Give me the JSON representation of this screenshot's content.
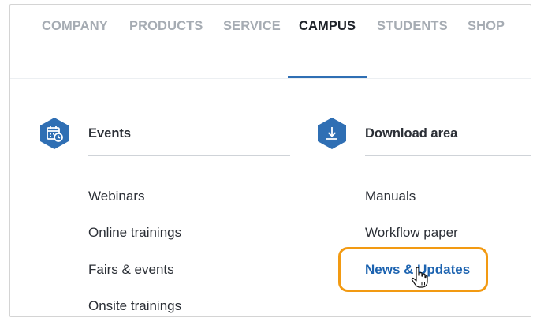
{
  "nav": {
    "items": [
      {
        "label": "COMPANY",
        "active": false
      },
      {
        "label": "PRODUCTS",
        "active": false
      },
      {
        "label": "SERVICE",
        "active": false
      },
      {
        "label": "CAMPUS",
        "active": true
      },
      {
        "label": "STUDENTS",
        "active": false
      },
      {
        "label": "SHOP",
        "active": false
      }
    ]
  },
  "columns": {
    "events": {
      "title": "Events",
      "icon": "calendar-clock-icon",
      "links": [
        "Webinars",
        "Online trainings",
        "Fairs & events",
        "Onsite trainings"
      ]
    },
    "downloads": {
      "title": "Download area",
      "icon": "download-icon",
      "links": [
        "Manuals",
        "Workflow paper",
        "News & Updates"
      ]
    }
  },
  "colors": {
    "accent": "#2f6fb4",
    "link_active": "#1c63b0",
    "highlight_outline": "#f29a12",
    "nav_inactive": "#a6acb3",
    "text": "#2b2f36"
  }
}
